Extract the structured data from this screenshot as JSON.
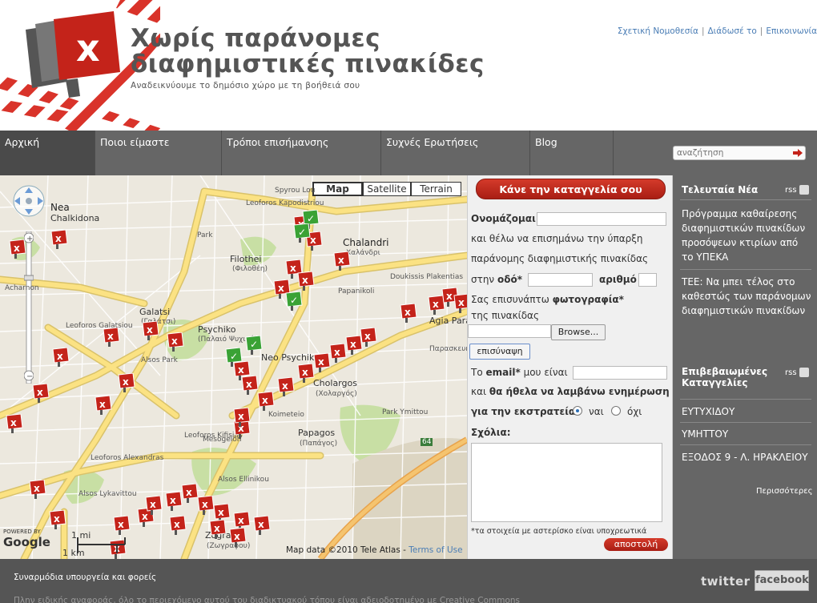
{
  "header": {
    "title_line1": "Χωρίς παράνομες",
    "title_line2": "διαφημιστικές πινακίδες",
    "subtitle": "Αναδεικνύουμε το δημόσιο χώρο με τη βοήθειά σου",
    "links": [
      "Σχετική Νομοθεσία",
      "Διάδωσέ το",
      "Επικοινωνία"
    ],
    "separator": "|"
  },
  "nav": {
    "items": [
      "Αρχική",
      "Ποιοι είμαστε",
      "Τρόποι επισήμανσης",
      "Συχνές Ερωτήσεις",
      "Blog"
    ],
    "active": "Αρχική",
    "search_placeholder": "αναζήτηση"
  },
  "map": {
    "types": [
      "Map",
      "Satellite",
      "Terrain"
    ],
    "selected_type": "Map",
    "labels": {
      "nea": "Nea",
      "chalkidona": "Chalkidona",
      "chalandri": "Chalandri",
      "chalandri_gr": "Χαλάνδρι",
      "filothei": "Filothei",
      "filothei_gr": "(Φιλοθέη)",
      "galatsi": "Galatsi",
      "galatsi_gr": "(Γαλάτσι)",
      "psychiko": "Psychiko",
      "psychiko_gr": "(Παλαιό Ψυχικό)",
      "alsos_park": "Alsos Park",
      "neo_psychiko": "Neo Psychiko",
      "cholargos": "Cholargos",
      "cholargos_gr": "(Χολαργός)",
      "agia_paraskevi": "Agia Paraske",
      "agia_paraskevi_gr": "Παρασκευή",
      "papagos": "Papagos",
      "papagos_gr": "(Παπάγος)",
      "zografou": "Zografou",
      "zografou_gr": "(Ζωγράφου)",
      "koimeteio": "Koimeteio",
      "park_ymittou": "Park Ymittou",
      "alsos_lykavittou": "Alsos Lykavittou",
      "alsos_ellinikou": "Alsos Ellinikou",
      "leof_kifisias": "Leoforos Kifisias",
      "leof_mesogeion": "Mesogeion",
      "leof_alexandras": "Leoforos Alexandras",
      "leof_galatsiou": "Leoforos Galatsiou",
      "leof_kapodistriou": "Leoforos Kapodistriou",
      "leof_plakentias": "Doukissis Plakentias",
      "papanikoli": "Papanikoli",
      "spyrou_louis": "Spyrou Lou",
      "achamon": "Acharnon",
      "park": "Park"
    },
    "scale_mi": "1 mi",
    "scale_km": "1 km",
    "credit": "Map data ©2010 Tele Atlas -",
    "terms": "Terms of Use",
    "powered_by": "POWERED BY",
    "google": "Google",
    "road_64": "64"
  },
  "form": {
    "report_button": "Κάνε την καταγγελία σου",
    "name_label": "Ονομάζομαι",
    "intro_1": "και θέλω να επισημάνω την ύπαρξη",
    "intro_2": "παράνομης διαφημιστικής πινακίδας",
    "street_prefix": "στην",
    "street_label": "οδό*",
    "number_label": "αριθμό",
    "photo_prefix": "Σας επισυνάπτω",
    "photo_label": "φωτογραφία*",
    "photo_suffix": "της πινακίδας",
    "browse_button": "Browse...",
    "attach_button": "επισύναψη",
    "email_prefix": "Το",
    "email_label": "email*",
    "email_suffix": "μου είναι",
    "updates_prefix": "και",
    "updates_text": "θα ήθελα να λαμβάνω ενημέρωση",
    "campaign_text": "για την εκστρατεία",
    "yes": "ναι",
    "no": "όχι",
    "comments_label": "Σχόλια:",
    "required_note": "*τα στοιχεία με αστερίσκο είναι υποχρεωτικά",
    "send_button": "αποστολή"
  },
  "sidebar": {
    "news_title": "Τελευταία Νέα",
    "rss": "rss",
    "news": [
      "Πρόγραμμα καθαίρεσης διαφημιστικών πινακίδων προσόψεων κτιρίων από το ΥΠΕΚΑ",
      "ΤΕΕ: Να μπει τέλος στο καθεστώς των παράνομων διαφημιστικών πινακίδων"
    ],
    "confirmed_title_1": "Επιβεβαιωμένες",
    "confirmed_title_2": "Καταγγελίες",
    "confirmed": [
      "ΕΥΤΥΧΙΔΟΥ",
      "ΥΜΗΤΤΟΥ",
      "ΕΞΟΔΟΣ 9 - Λ. ΗΡΑΚΛΕΙΟΥ"
    ],
    "more": "Περισσότερες"
  },
  "footer": {
    "partners": "Συναρμόδια υπουργεία και φορείς",
    "license": "Πλην ειδικής αναφοράς, όλο το περιεχόμενο αυτού του διαδικτυακού τόπου είναι αδειοδοτημένο με Creative Commons",
    "twitter": "twitter",
    "facebook": "facebook"
  },
  "colors": {
    "nav_bg": "#666666",
    "accent_red": "#c0281c",
    "link_blue": "#4a7db5",
    "road_yellow": "#fbe283",
    "pin_green": "#3aa235"
  }
}
